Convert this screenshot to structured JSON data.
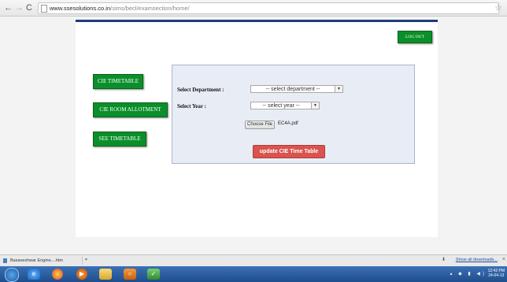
{
  "browser": {
    "url_host": "www.ssesolutions.co.in",
    "url_path": "/sims/becl/examsection/home/"
  },
  "header": {
    "logout_label": "LOG OUT"
  },
  "sidebar": {
    "items": [
      {
        "label": "CIE TIMETABLE"
      },
      {
        "label": "CIE ROOM ALLOTMENT"
      },
      {
        "label": "SEE TIMETABLE"
      }
    ]
  },
  "form": {
    "department_label": "Select Department :",
    "department_value": "-- select department --",
    "year_label": "Select Year :",
    "year_value": "-- select year --",
    "choose_file_label": "Choose File",
    "file_name": "EC4A.pdf",
    "submit_label": "update CIE Time Table"
  },
  "download_bar": {
    "file_label": "Basavezhwar Engine....htm",
    "show_all_label": "Show all downloads..."
  },
  "taskbar": {
    "time": "12:42 PM",
    "date": "24-04-13"
  }
}
